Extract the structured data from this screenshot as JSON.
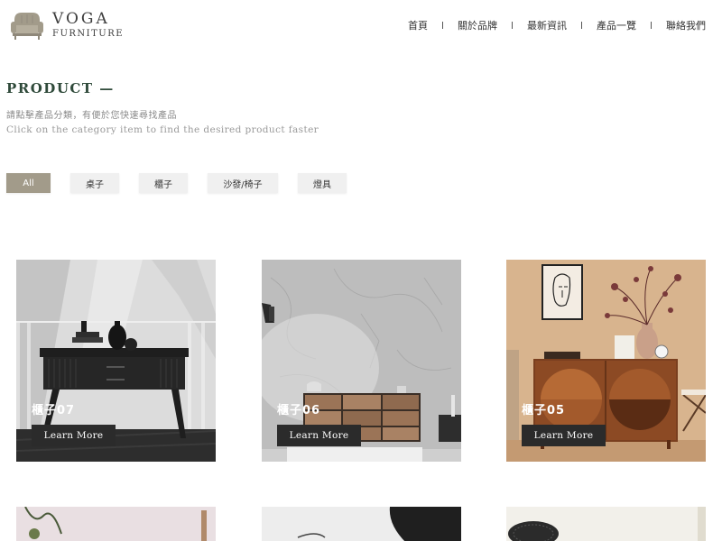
{
  "brand": {
    "name": "VOGA",
    "sub": "FURNITURE",
    "logo_icon": "armchair-icon"
  },
  "nav": [
    {
      "label": "首頁"
    },
    {
      "label": "關於品牌"
    },
    {
      "label": "最新資訊"
    },
    {
      "label": "產品一覽"
    },
    {
      "label": "聯絡我們"
    }
  ],
  "section": {
    "title": "PRODUCT —",
    "desc_zh": "請點擊產品分類，有便於您快速尋找產品",
    "desc_en": "Click on the category item to find the desired product faster"
  },
  "filters": [
    {
      "label": "All",
      "active": true
    },
    {
      "label": "桌子",
      "active": false
    },
    {
      "label": "櫃子",
      "active": false
    },
    {
      "label": "沙發/椅子",
      "active": false
    },
    {
      "label": "燈具",
      "active": false
    }
  ],
  "products": [
    {
      "label": "櫃子07",
      "button": "Learn More"
    },
    {
      "label": "櫃子06",
      "button": "Learn More"
    },
    {
      "label": "櫃子05",
      "button": "Learn More"
    }
  ],
  "colors": {
    "accent": "#a29b8a",
    "heading": "#2f4a3a",
    "button_dark": "#2b2b2b"
  }
}
